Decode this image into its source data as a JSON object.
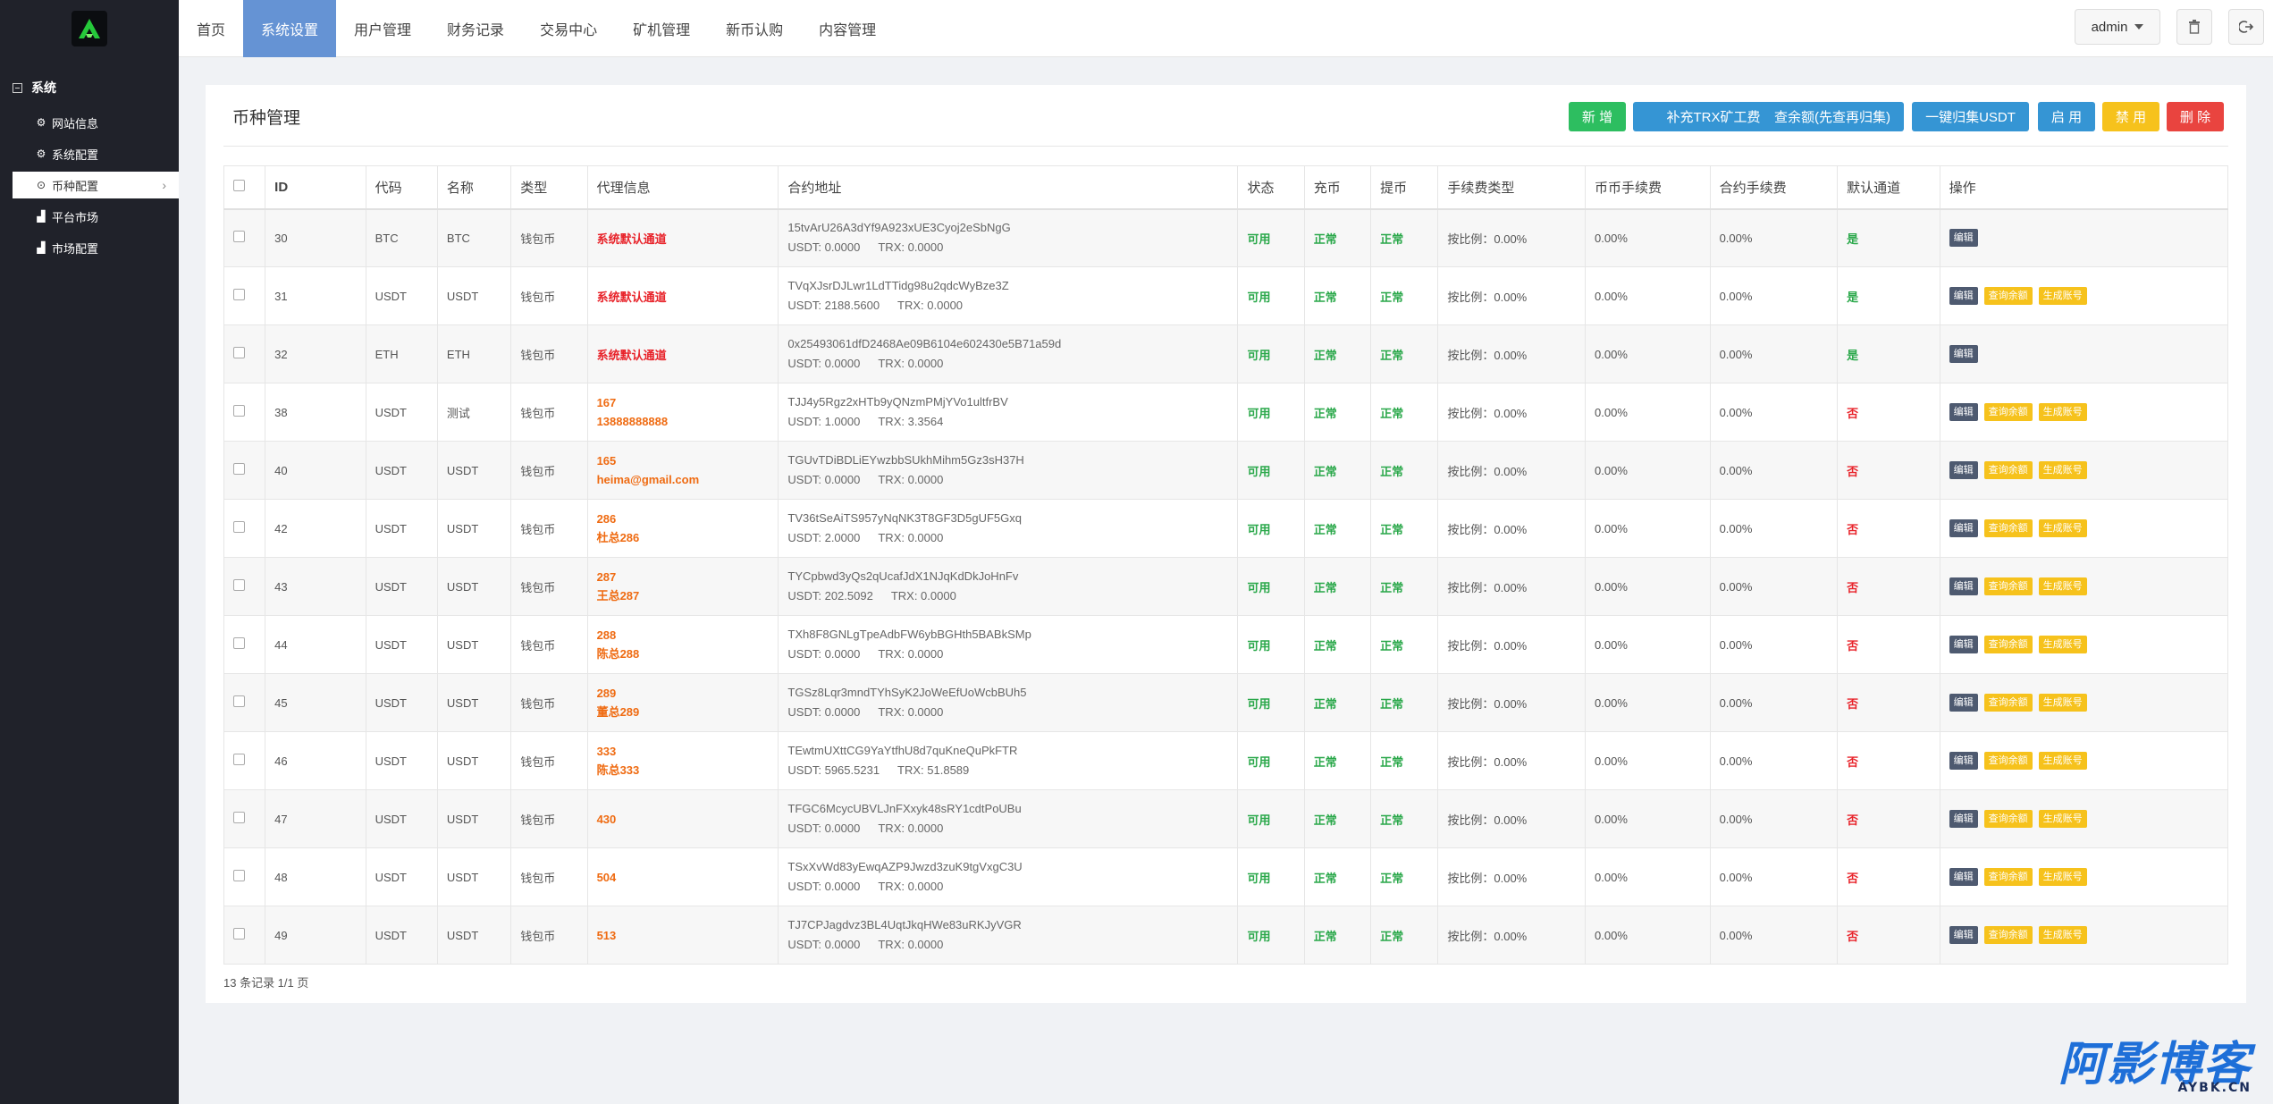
{
  "sidebar": {
    "group_label": "系统",
    "items": [
      {
        "label": "网站信息",
        "icon": "gear-icon"
      },
      {
        "label": "系统配置",
        "icon": "gear-icon"
      },
      {
        "label": "币种配置",
        "icon": "circle-icon"
      },
      {
        "label": "平台市场",
        "icon": "bar-chart-icon"
      },
      {
        "label": "市场配置",
        "icon": "bar-chart-icon"
      }
    ]
  },
  "header": {
    "tabs": [
      "首页",
      "系统设置",
      "用户管理",
      "财务记录",
      "交易中心",
      "矿机管理",
      "新币认购",
      "内容管理"
    ],
    "active_tab": "系统设置",
    "user": "admin"
  },
  "page": {
    "title": "币种管理",
    "buttons": {
      "add": "新 增",
      "topup_trx": "补充TRX矿工费",
      "query_balance": "查余额(先查再归集)",
      "collect_usdt": "一键归集USDT",
      "enable": "启 用",
      "disable": "禁 用",
      "delete": "删 除"
    },
    "columns": [
      "ID",
      "代码",
      "名称",
      "类型",
      "代理信息",
      "合约地址",
      "状态",
      "充币",
      "提币",
      "手续费类型",
      "币币手续费",
      "合约手续费",
      "默认通道",
      "操作"
    ],
    "row_actions": {
      "edit": "编辑",
      "query": "查询余额",
      "generate": "生成账号"
    },
    "rows": [
      {
        "id": "30",
        "code": "BTC",
        "name": "BTC",
        "type": "钱包币",
        "agent1": "系统默认通道",
        "agent2": "",
        "agent_style": "red",
        "address": "15tvArU26A3dYf9A923xUE3Cyoj2eSbNgG",
        "usdt": "USDT:  0.0000",
        "trx": "TRX:  0.0000",
        "status": "可用",
        "deposit": "正常",
        "withdraw": "正常",
        "fee_type": "按比例：0.00%",
        "spot_fee": "0.00%",
        "contract_fee": "0.00%",
        "default": "是",
        "default_style": "yes",
        "full_actions": false
      },
      {
        "id": "31",
        "code": "USDT",
        "name": "USDT",
        "type": "钱包币",
        "agent1": "系统默认通道",
        "agent2": "",
        "agent_style": "red",
        "address": "TVqXJsrDJLwr1LdTTidg98u2qdcWyBze3Z",
        "usdt": "USDT:  2188.5600",
        "trx": "TRX:  0.0000",
        "status": "可用",
        "deposit": "正常",
        "withdraw": "正常",
        "fee_type": "按比例：0.00%",
        "spot_fee": "0.00%",
        "contract_fee": "0.00%",
        "default": "是",
        "default_style": "yes",
        "full_actions": true
      },
      {
        "id": "32",
        "code": "ETH",
        "name": "ETH",
        "type": "钱包币",
        "agent1": "系统默认通道",
        "agent2": "",
        "agent_style": "red",
        "address": "0x25493061dfD2468Ae09B6104e602430e5B71a59d",
        "usdt": "USDT:  0.0000",
        "trx": "TRX:  0.0000",
        "status": "可用",
        "deposit": "正常",
        "withdraw": "正常",
        "fee_type": "按比例：0.00%",
        "spot_fee": "0.00%",
        "contract_fee": "0.00%",
        "default": "是",
        "default_style": "yes",
        "full_actions": false
      },
      {
        "id": "38",
        "code": "USDT",
        "name": "测试",
        "type": "钱包币",
        "agent1": "167",
        "agent2": "13888888888",
        "agent_style": "orange",
        "address": "TJJ4y5Rgz2xHTb9yQNzmPMjYVo1ultfrBV",
        "usdt": "USDT:  1.0000",
        "trx": "TRX:  3.3564",
        "status": "可用",
        "deposit": "正常",
        "withdraw": "正常",
        "fee_type": "按比例：0.00%",
        "spot_fee": "0.00%",
        "contract_fee": "0.00%",
        "default": "否",
        "default_style": "no",
        "full_actions": true
      },
      {
        "id": "40",
        "code": "USDT",
        "name": "USDT",
        "type": "钱包币",
        "agent1": "165",
        "agent2": "heima@gmail.com",
        "agent_style": "orange",
        "address": "TGUvTDiBDLiEYwzbbSUkhMihm5Gz3sH37H",
        "usdt": "USDT:  0.0000",
        "trx": "TRX:  0.0000",
        "status": "可用",
        "deposit": "正常",
        "withdraw": "正常",
        "fee_type": "按比例：0.00%",
        "spot_fee": "0.00%",
        "contract_fee": "0.00%",
        "default": "否",
        "default_style": "no",
        "full_actions": true
      },
      {
        "id": "42",
        "code": "USDT",
        "name": "USDT",
        "type": "钱包币",
        "agent1": "286",
        "agent2": "杜总286",
        "agent_style": "orange",
        "address": "TV36tSeAiTS957yNqNK3T8GF3D5gUF5Gxq",
        "usdt": "USDT:  2.0000",
        "trx": "TRX:  0.0000",
        "status": "可用",
        "deposit": "正常",
        "withdraw": "正常",
        "fee_type": "按比例：0.00%",
        "spot_fee": "0.00%",
        "contract_fee": "0.00%",
        "default": "否",
        "default_style": "no",
        "full_actions": true
      },
      {
        "id": "43",
        "code": "USDT",
        "name": "USDT",
        "type": "钱包币",
        "agent1": "287",
        "agent2": "王总287",
        "agent_style": "orange",
        "address": "TYCpbwd3yQs2qUcafJdX1NJqKdDkJoHnFv",
        "usdt": "USDT:  202.5092",
        "trx": "TRX:  0.0000",
        "status": "可用",
        "deposit": "正常",
        "withdraw": "正常",
        "fee_type": "按比例：0.00%",
        "spot_fee": "0.00%",
        "contract_fee": "0.00%",
        "default": "否",
        "default_style": "no",
        "full_actions": true
      },
      {
        "id": "44",
        "code": "USDT",
        "name": "USDT",
        "type": "钱包币",
        "agent1": "288",
        "agent2": "陈总288",
        "agent_style": "orange",
        "address": "TXh8F8GNLgTpeAdbFW6ybBGHth5BABkSMp",
        "usdt": "USDT:  0.0000",
        "trx": "TRX:  0.0000",
        "status": "可用",
        "deposit": "正常",
        "withdraw": "正常",
        "fee_type": "按比例：0.00%",
        "spot_fee": "0.00%",
        "contract_fee": "0.00%",
        "default": "否",
        "default_style": "no",
        "full_actions": true
      },
      {
        "id": "45",
        "code": "USDT",
        "name": "USDT",
        "type": "钱包币",
        "agent1": "289",
        "agent2": "董总289",
        "agent_style": "orange",
        "address": "TGSz8Lqr3mndTYhSyK2JoWeEfUoWcbBUh5",
        "usdt": "USDT:  0.0000",
        "trx": "TRX:  0.0000",
        "status": "可用",
        "deposit": "正常",
        "withdraw": "正常",
        "fee_type": "按比例：0.00%",
        "spot_fee": "0.00%",
        "contract_fee": "0.00%",
        "default": "否",
        "default_style": "no",
        "full_actions": true
      },
      {
        "id": "46",
        "code": "USDT",
        "name": "USDT",
        "type": "钱包币",
        "agent1": "333",
        "agent2": "陈总333",
        "agent_style": "orange",
        "address": "TEwtmUXttCG9YaYtfhU8d7quKneQuPkFTR",
        "usdt": "USDT:  5965.5231",
        "trx": "TRX:  51.8589",
        "status": "可用",
        "deposit": "正常",
        "withdraw": "正常",
        "fee_type": "按比例：0.00%",
        "spot_fee": "0.00%",
        "contract_fee": "0.00%",
        "default": "否",
        "default_style": "no",
        "full_actions": true
      },
      {
        "id": "47",
        "code": "USDT",
        "name": "USDT",
        "type": "钱包币",
        "agent1": "430",
        "agent2": "",
        "agent_style": "orange",
        "address": "TFGC6McycUBVLJnFXxyk48sRY1cdtPoUBu",
        "usdt": "USDT:  0.0000",
        "trx": "TRX:  0.0000",
        "status": "可用",
        "deposit": "正常",
        "withdraw": "正常",
        "fee_type": "按比例：0.00%",
        "spot_fee": "0.00%",
        "contract_fee": "0.00%",
        "default": "否",
        "default_style": "no",
        "full_actions": true
      },
      {
        "id": "48",
        "code": "USDT",
        "name": "USDT",
        "type": "钱包币",
        "agent1": "504",
        "agent2": "",
        "agent_style": "orange",
        "address": "TSxXvWd83yEwqAZP9Jwzd3zuK9tgVxgC3U",
        "usdt": "USDT:  0.0000",
        "trx": "TRX:  0.0000",
        "status": "可用",
        "deposit": "正常",
        "withdraw": "正常",
        "fee_type": "按比例：0.00%",
        "spot_fee": "0.00%",
        "contract_fee": "0.00%",
        "default": "否",
        "default_style": "no",
        "full_actions": true
      },
      {
        "id": "49",
        "code": "USDT",
        "name": "USDT",
        "type": "钱包币",
        "agent1": "513",
        "agent2": "",
        "agent_style": "orange",
        "address": "TJ7CPJagdvz3BL4UqtJkqHWe83uRKJyVGR",
        "usdt": "USDT:  0.0000",
        "trx": "TRX:  0.0000",
        "status": "可用",
        "deposit": "正常",
        "withdraw": "正常",
        "fee_type": "按比例：0.00%",
        "spot_fee": "0.00%",
        "contract_fee": "0.00%",
        "default": "否",
        "default_style": "no",
        "full_actions": true
      }
    ],
    "footer": "13 条记录 1/1 页"
  },
  "watermark": {
    "cn": "阿影博客",
    "en": "AYBK.CN"
  },
  "colors": {
    "sidebar_bg": "#20222a",
    "nav_active": "#6593d4",
    "green": "#2dbe60",
    "blue": "#3595d4",
    "yellow": "#f6c21c",
    "red": "#e9443f"
  }
}
